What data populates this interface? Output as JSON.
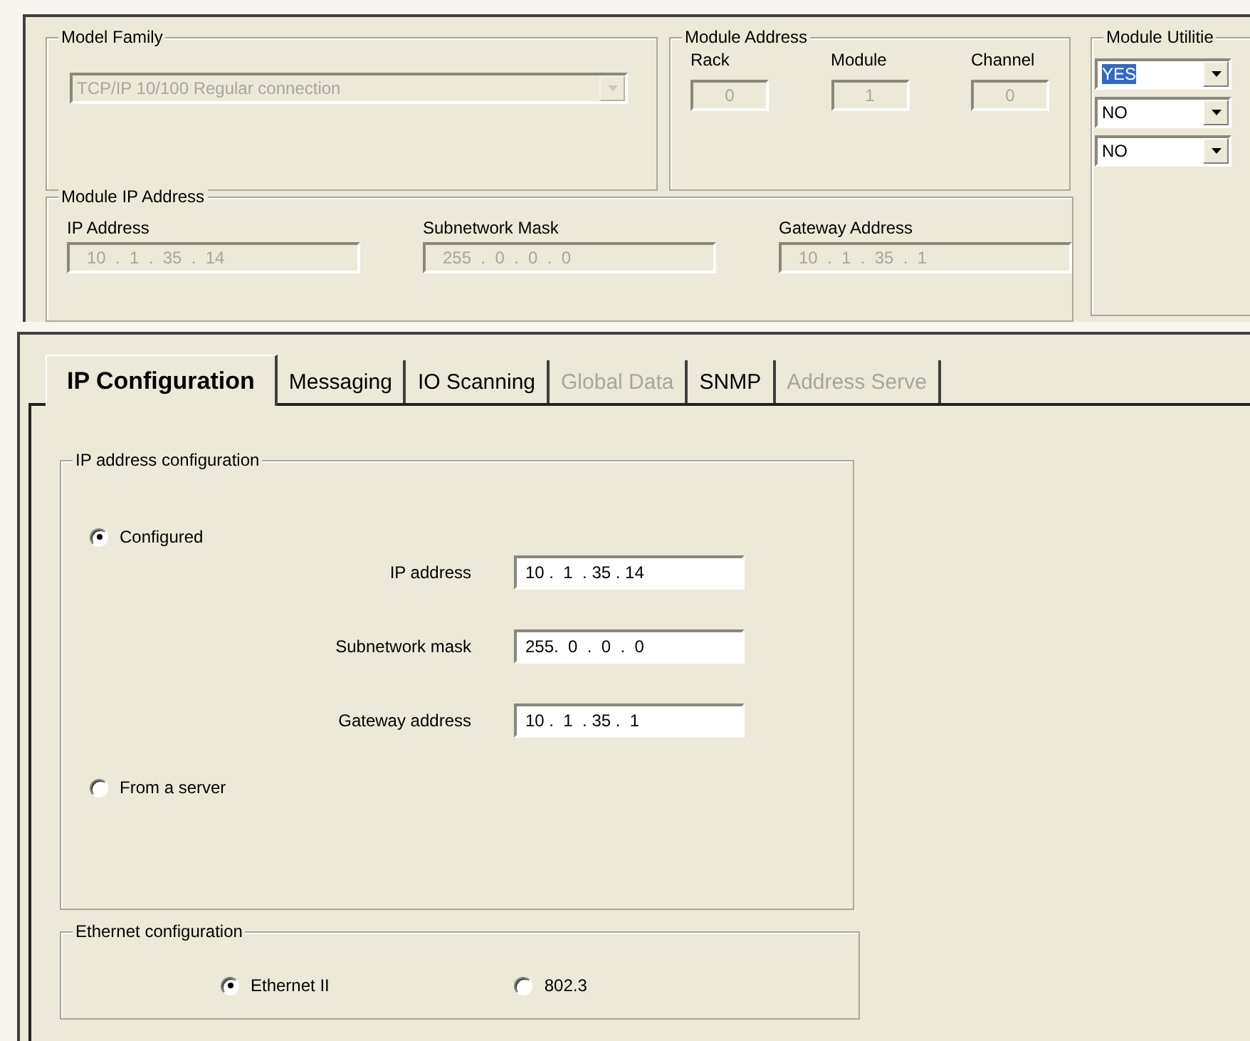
{
  "model_family": {
    "title": "Model Family",
    "value": "TCP/IP 10/100 Regular connection",
    "disabled": true
  },
  "module_address": {
    "title": "Module Address",
    "fields": [
      {
        "label": "Rack",
        "value": "0"
      },
      {
        "label": "Module",
        "value": "1"
      },
      {
        "label": "Channel",
        "value": "0"
      }
    ]
  },
  "module_ip_address": {
    "title": "Module IP Address",
    "fields": [
      {
        "label": "IP Address",
        "value": "10  .  1  .  35  .  14"
      },
      {
        "label": "Subnetwork Mask",
        "value": "255  .  0  .  0  .  0"
      },
      {
        "label": "Gateway Address",
        "value": "10  .  1  .  35  .  1"
      }
    ]
  },
  "module_utilities": {
    "title": "Module Utilitie",
    "dropdowns": [
      {
        "value": "YES",
        "focused": true
      },
      {
        "value": "NO",
        "focused": false
      },
      {
        "value": "NO",
        "focused": false
      }
    ]
  },
  "tabs": [
    {
      "label": "IP Configuration",
      "selected": true,
      "disabled": false
    },
    {
      "label": "Messaging",
      "selected": false,
      "disabled": false
    },
    {
      "label": "IO Scanning",
      "selected": false,
      "disabled": false
    },
    {
      "label": "Global Data",
      "selected": false,
      "disabled": true
    },
    {
      "label": "SNMP",
      "selected": false,
      "disabled": false
    },
    {
      "label": "Address Serve",
      "selected": false,
      "disabled": true
    }
  ],
  "ip_address_configuration": {
    "title": "IP address configuration",
    "options": [
      {
        "label": "Configured",
        "selected": true
      },
      {
        "label": "From a server",
        "selected": false
      }
    ],
    "fields": [
      {
        "label": "IP address",
        "value": "10 .  1  . 35 . 14"
      },
      {
        "label": "Subnetwork mask",
        "value": "255.  0  .  0  .  0"
      },
      {
        "label": "Gateway address",
        "value": "10 .  1  . 35 .  1"
      }
    ]
  },
  "ethernet_configuration": {
    "title": "Ethernet configuration",
    "options": [
      {
        "label": "Ethernet II",
        "selected": true
      },
      {
        "label": "802.3",
        "selected": false
      }
    ]
  }
}
